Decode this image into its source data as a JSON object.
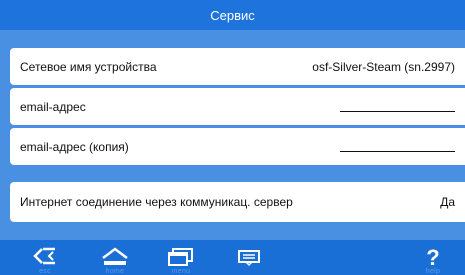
{
  "header": {
    "title": "Сервис"
  },
  "settings": [
    {
      "label": "Сетевое имя устройства",
      "value": "osf-Silver-Steam (sn.2997)"
    },
    {
      "label": "email-адрес",
      "value": ""
    },
    {
      "label": "email-адрес (копия)",
      "value": ""
    },
    {
      "label": "Интернет соединение через коммуникац. сервер",
      "value": "Да"
    }
  ],
  "nav": {
    "esc_label": "esc",
    "home_label": "home",
    "menu_label": "menu",
    "help_label": "help"
  },
  "colors": {
    "bar": "#1a6fd6",
    "content_bg": "#4a90e2",
    "icon": "#ffffff"
  }
}
